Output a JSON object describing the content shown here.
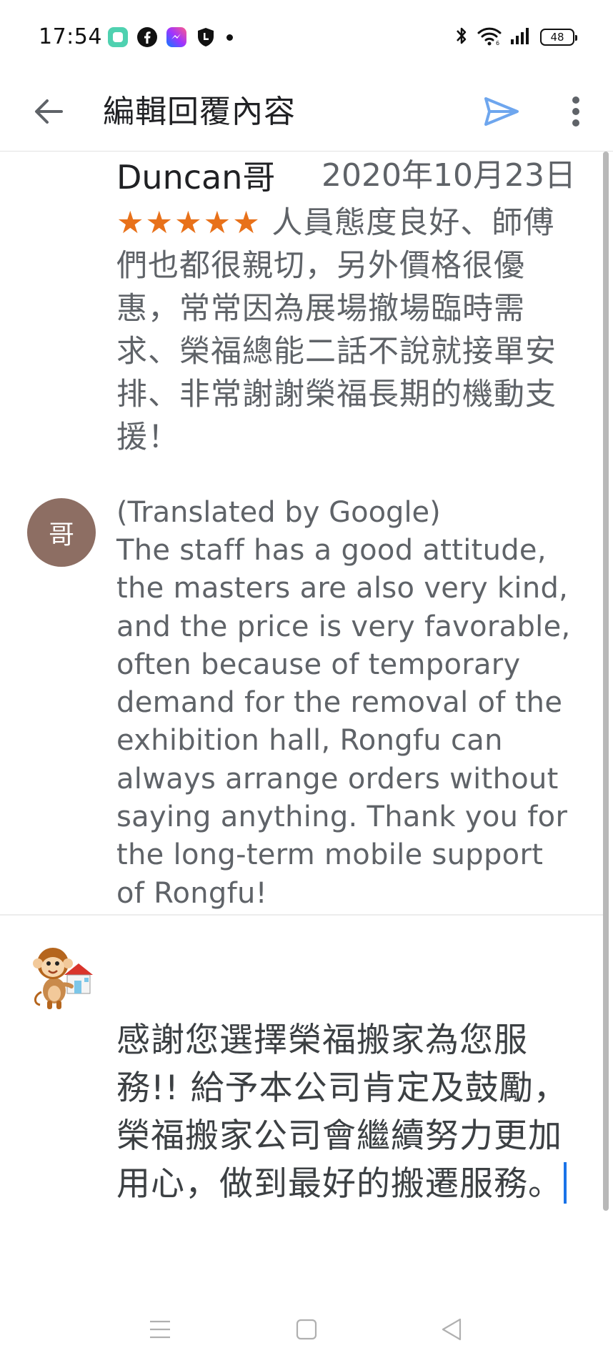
{
  "status_bar": {
    "time": "17:54",
    "notification_icons": [
      "messages-app-icon",
      "facebook-icon",
      "messenger-icon",
      "shield-app-icon"
    ],
    "battery_level": "48"
  },
  "app_bar": {
    "title": "編輯回覆內容",
    "icons": [
      "back-arrow-icon",
      "send-icon",
      "more-vert-icon"
    ]
  },
  "review": {
    "reviewer_name": "Duncan哥",
    "date": "2020年10月23日",
    "stars": "★★★★★",
    "rating": 5,
    "text": "人員態度良好、師傅們也都很親切，另外價格很優惠，常常因為展場撤場臨時需求、榮福總能二話不說就接單安排、非常謝謝榮福長期的機動支援！",
    "avatar_letter": "哥",
    "translated_label": "(Translated by Google)",
    "translated_text": "The staff has a good attitude, the masters are also very kind, and the price is very favorable, often because of temporary demand for the removal of the exhibition hall, Rongfu can always arrange orders without saying anything. Thank you for the long-term mobile support of Rongfu!"
  },
  "reply": {
    "value": "感謝您選擇榮福搬家為您服務!! 給予本公司肯定及鼓勵，榮福搬家公司會繼續努力更加用心，做到最好的搬遷服務。"
  },
  "colors": {
    "accent": "#1a73e8",
    "send_icon": "#6ea6ee",
    "stars": "#e8711a",
    "avatar_bg": "#8d6e63",
    "secondary_text": "#5f6368"
  },
  "nav_bar": {
    "buttons": [
      "menu-icon",
      "home-icon",
      "back-triangle-icon"
    ]
  }
}
